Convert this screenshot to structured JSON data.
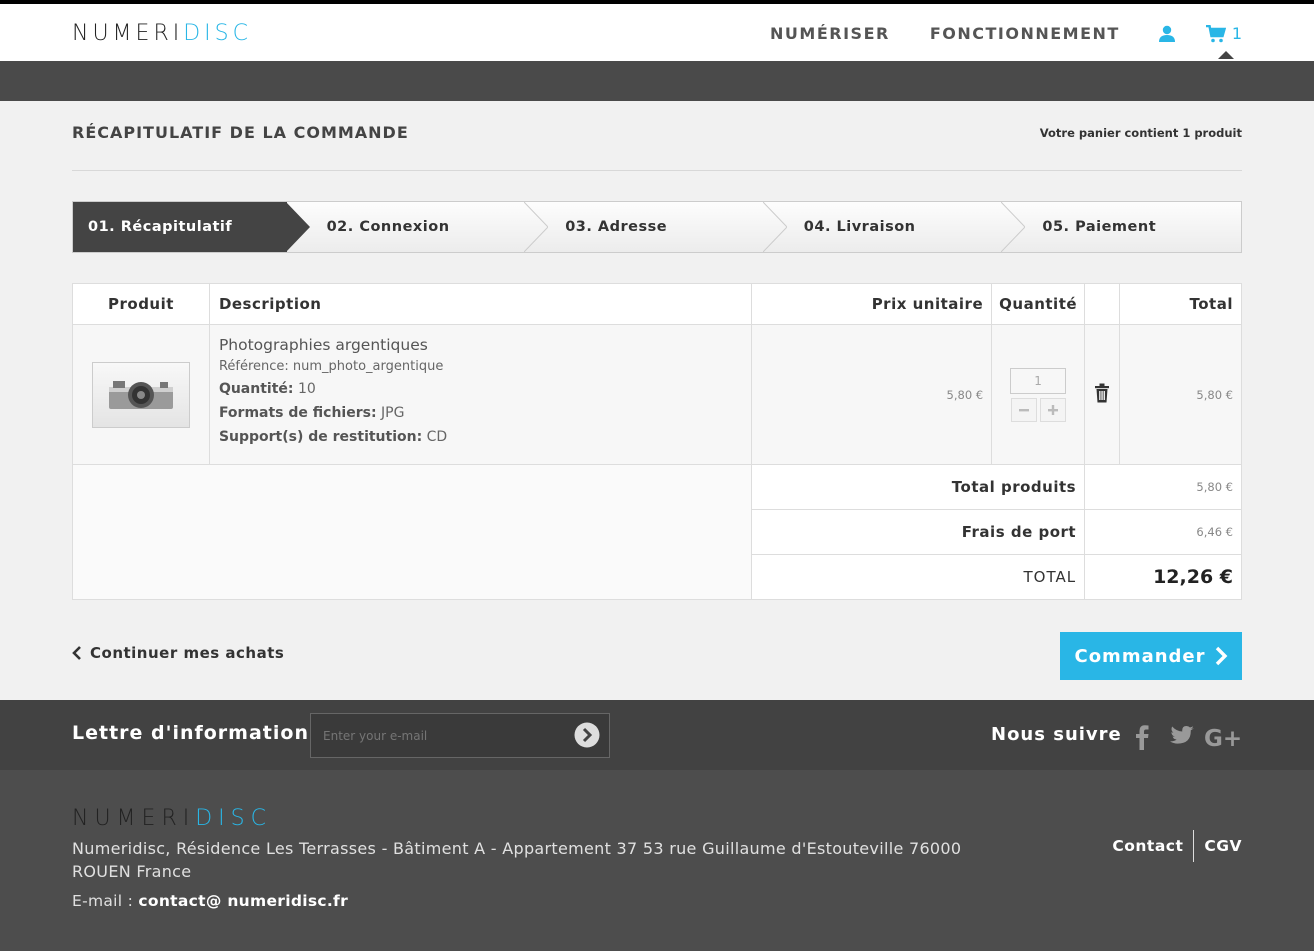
{
  "header": {
    "logo_part1": "NUMERI",
    "logo_part2": "DISC",
    "nav": [
      "NUMÉRISER",
      "FONCTIONNEMENT"
    ],
    "cart_count": "1"
  },
  "page": {
    "title": "RÉCAPITULATIF DE LA COMMANDE",
    "cart_summary": "Votre panier contient 1 produit"
  },
  "steps": [
    "01. Récapitulatif",
    "02. Connexion",
    "03. Adresse",
    "04. Livraison",
    "05. Paiement"
  ],
  "table": {
    "headers": {
      "product": "Produit",
      "description": "Description",
      "unit_price": "Prix unitaire",
      "quantity": "Quantité",
      "total": "Total"
    },
    "item": {
      "name": "Photographies argentiques",
      "reference": "Référence: num_photo_argentique",
      "qty_label": "Quantité:",
      "qty_value": "10",
      "formats_label": "Formats de fichiers:",
      "formats_value": "JPG",
      "support_label": "Support(s) de restitution:",
      "support_value": "CD",
      "unit_price": "5,80 €",
      "quantity": "1",
      "total": "5,80 €"
    },
    "summary": {
      "products_label": "Total produits",
      "products_value": "5,80 €",
      "shipping_label": "Frais de port",
      "shipping_value": "6,46 €",
      "total_label": "TOTAL",
      "total_value": "12,26 €"
    }
  },
  "actions": {
    "continue": "Continuer mes achats",
    "order": "Commander"
  },
  "newsletter": {
    "title": "Lettre d'informations",
    "placeholder": "Enter your e-mail",
    "follow": "Nous suivre"
  },
  "footer": {
    "logo_part1": "NUMERI",
    "logo_part2": "DISC",
    "address": "Numeridisc, Résidence Les Terrasses - Bâtiment A - Appartement 37 53 rue Guillaume d'Estouteville 76000 ROUEN France",
    "email_label": "E-mail :",
    "email": "contact@ numeridisc.fr",
    "links": [
      "Contact",
      "CGV"
    ]
  },
  "colors": {
    "accent": "#29b6e6",
    "dark": "#444444"
  }
}
